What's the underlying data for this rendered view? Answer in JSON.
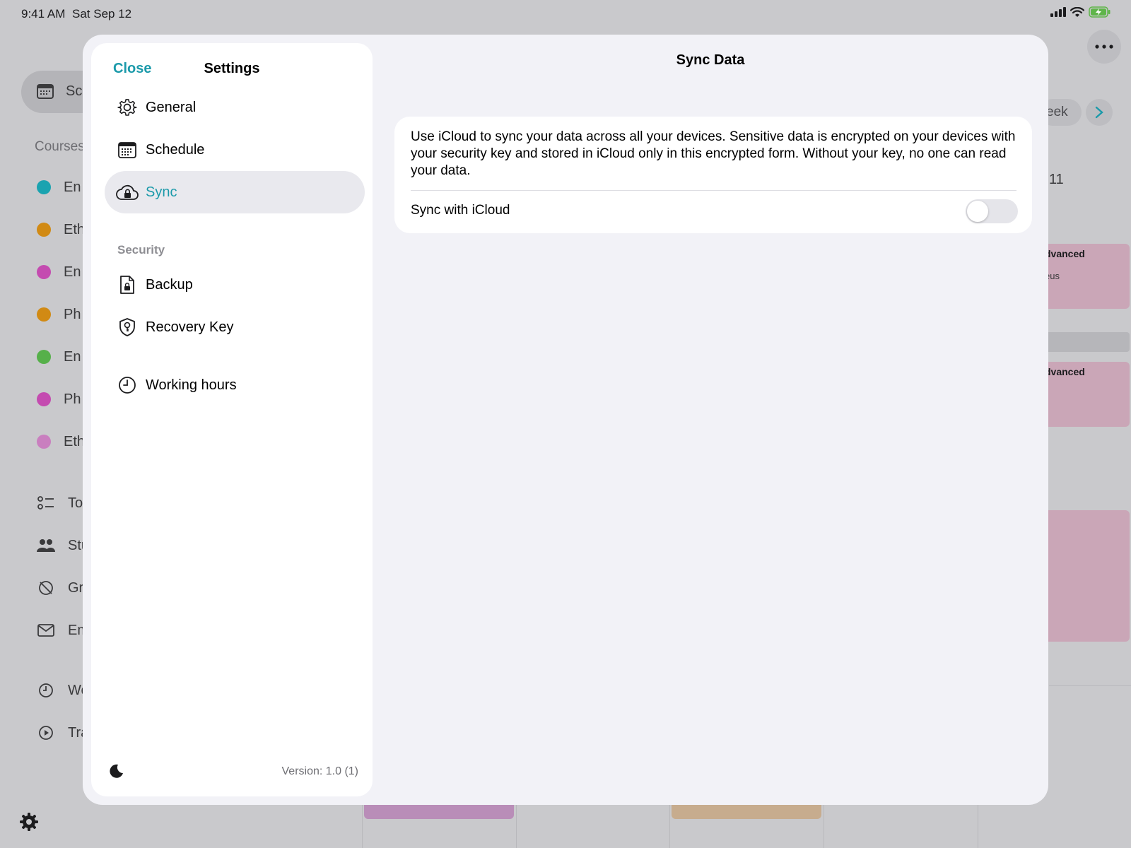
{
  "status_bar": {
    "time": "9:41 AM",
    "date": "Sat Sep 12"
  },
  "background": {
    "sidebar_selected_label": "Sc",
    "courses_header": "Courses",
    "courses": [
      {
        "label": "En",
        "color": "#1aa3b0"
      },
      {
        "label": "Eth",
        "color": "#d18a14"
      },
      {
        "label": "En",
        "color": "#c44bb0"
      },
      {
        "label": "Ph",
        "color": "#d18a14"
      },
      {
        "label": "En",
        "color": "#56b04a"
      },
      {
        "label": "Ph",
        "color": "#c44bb0"
      },
      {
        "label": "Eth",
        "color": "#c97fbf"
      }
    ],
    "nav": [
      {
        "label": "To",
        "icon": "checklist-icon"
      },
      {
        "label": "Stu",
        "icon": "people-icon"
      },
      {
        "label": "Gra",
        "icon": "grade-icon"
      },
      {
        "label": "Em",
        "icon": "envelope-icon"
      },
      {
        "label": "Wo",
        "icon": "clock-icon"
      },
      {
        "label": "Tra",
        "icon": "play-circle-icon"
      }
    ],
    "week_label": "eek",
    "day_label": "i 11",
    "events": [
      {
        "title": "dvanced",
        "subtitle": "eus"
      },
      {
        "title": "dvanced",
        "subtitle": ""
      }
    ]
  },
  "settings": {
    "close_label": "Close",
    "title": "Settings",
    "items": [
      {
        "label": "General",
        "icon": "gear-icon"
      },
      {
        "label": "Schedule",
        "icon": "calendar-icon"
      },
      {
        "label": "Sync",
        "icon": "cloud-lock-icon",
        "active": true
      }
    ],
    "security_header": "Security",
    "security_items": [
      {
        "label": "Backup",
        "icon": "document-lock-icon"
      },
      {
        "label": "Recovery Key",
        "icon": "shield-key-icon"
      }
    ],
    "other_items": [
      {
        "label": "Working hours",
        "icon": "clock-icon"
      }
    ],
    "version": "Version: 1.0 (1)",
    "accent_color": "#1b9aaa"
  },
  "detail": {
    "title": "Sync Data",
    "description": "Use iCloud to sync your data across all your devices. Sensitive data is encrypted on your devices with your security key and stored in iCloud only in this encrypted form. Without your key, no one can read your data.",
    "toggle_label": "Sync with iCloud",
    "toggle_on": false
  }
}
